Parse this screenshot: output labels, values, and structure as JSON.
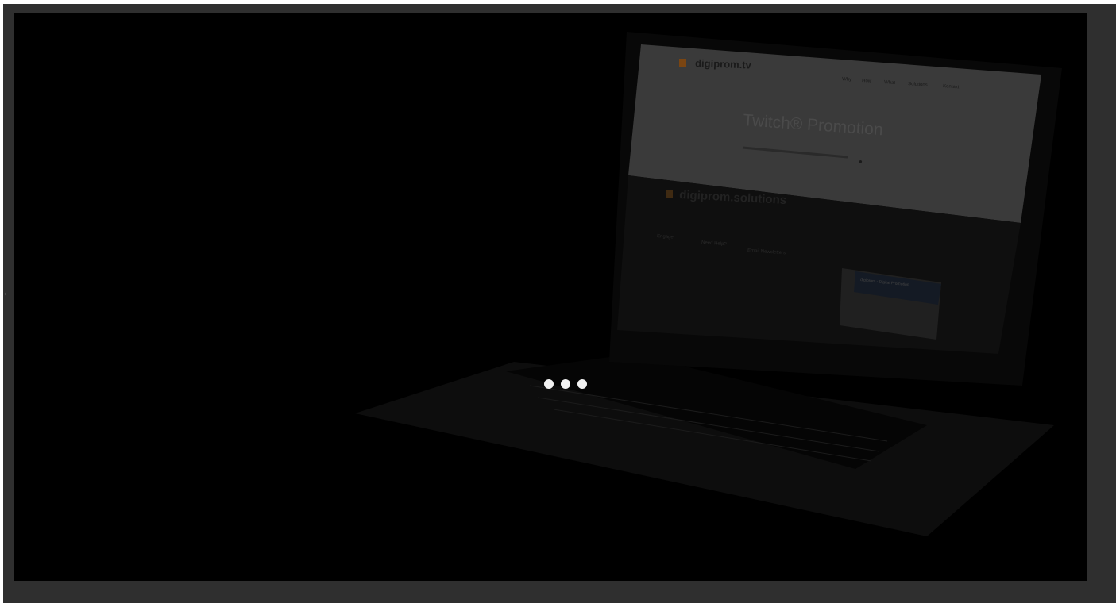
{
  "screen": {
    "site_name": "digiprom.tv",
    "nav": [
      "Why",
      "How",
      "What",
      "Solutions",
      "Kontakt"
    ],
    "hero_title": "Twitch® Promotion",
    "footer_brand": "digiprom.solutions",
    "footer_col1_title": "Engage",
    "footer_col2_title": "Need Help?",
    "footer_col3_title": "Email Newsletters",
    "fb_widget_title": "digiprom - Digital Promotion"
  },
  "controls": {
    "prev_arrow": "‹"
  },
  "colors": {
    "background_frame": "#2f2f2f",
    "stage": "#000000",
    "loader_dot": "#f2f2f2",
    "logo_accent": "#e07a1f"
  },
  "icons": [
    "search-icon",
    "logo-icon",
    "chevron-left-icon"
  ]
}
